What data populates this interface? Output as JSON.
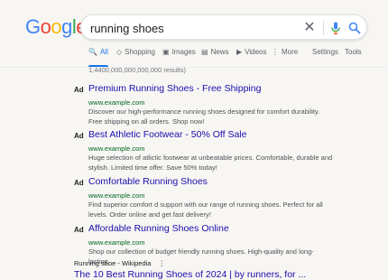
{
  "logo": {
    "letters": [
      "G",
      "o",
      "o",
      "g",
      "l",
      "e"
    ],
    "colors": [
      "#4285f4",
      "#ea4335",
      "#fbbc05",
      "#4285f4",
      "#34a853",
      "#ea4335"
    ]
  },
  "search": {
    "query": "running shoes"
  },
  "icons": {
    "clear": "close-icon",
    "mic": "mic-icon",
    "search": "search-icon"
  },
  "tabs": [
    {
      "label": "All",
      "icon": "🔍",
      "active": true
    },
    {
      "label": "Shopping",
      "icon": "◇",
      "active": false
    },
    {
      "label": "Images",
      "icon": "▣",
      "active": false
    },
    {
      "label": "News",
      "icon": "▤",
      "active": false
    },
    {
      "label": "Videos",
      "icon": "▶",
      "active": false
    },
    {
      "label": "More",
      "icon": "⋮",
      "active": false
    }
  ],
  "tools": {
    "settings": "Settings",
    "tools": "Tools"
  },
  "stats": "1,4400,000,000,000,000 results)",
  "ads": [
    {
      "badge": "Ad",
      "title": "Premium Running Shoes - Free Shipping",
      "url": "www.example.com",
      "desc": "Discover our high-performance running shoes designed for comfort durability. Free shipping on all orders. Shop now!"
    },
    {
      "badge": "Ad",
      "title": "Best Athletic Footwear - 50% Off Sale",
      "url": "www.example.com",
      "desc": "Huge selection of atlictic footwear at unbeatable prices. Comfortable, durable and stylish. Limited time offer. Save 50% today!"
    },
    {
      "badge": "Ad",
      "title": "Comfortable Running Shoes",
      "url": "www.example.com",
      "desc": "Find superior comfort d support with our range of running shoes. Perfect for all levels. Order online and get fast delivery!"
    },
    {
      "badge": "Ad",
      "title": "Affordable Running Shoes Online",
      "url": "www.example.com",
      "desc": "Shop our collection of budget friendly running shoes. High-quality and long-lasting."
    }
  ],
  "organic": {
    "source": "Running shoe - Wikipedia",
    "more": "⋮",
    "title": "The 10 Best Running Shoes of 2024 | by runners, for ..."
  }
}
